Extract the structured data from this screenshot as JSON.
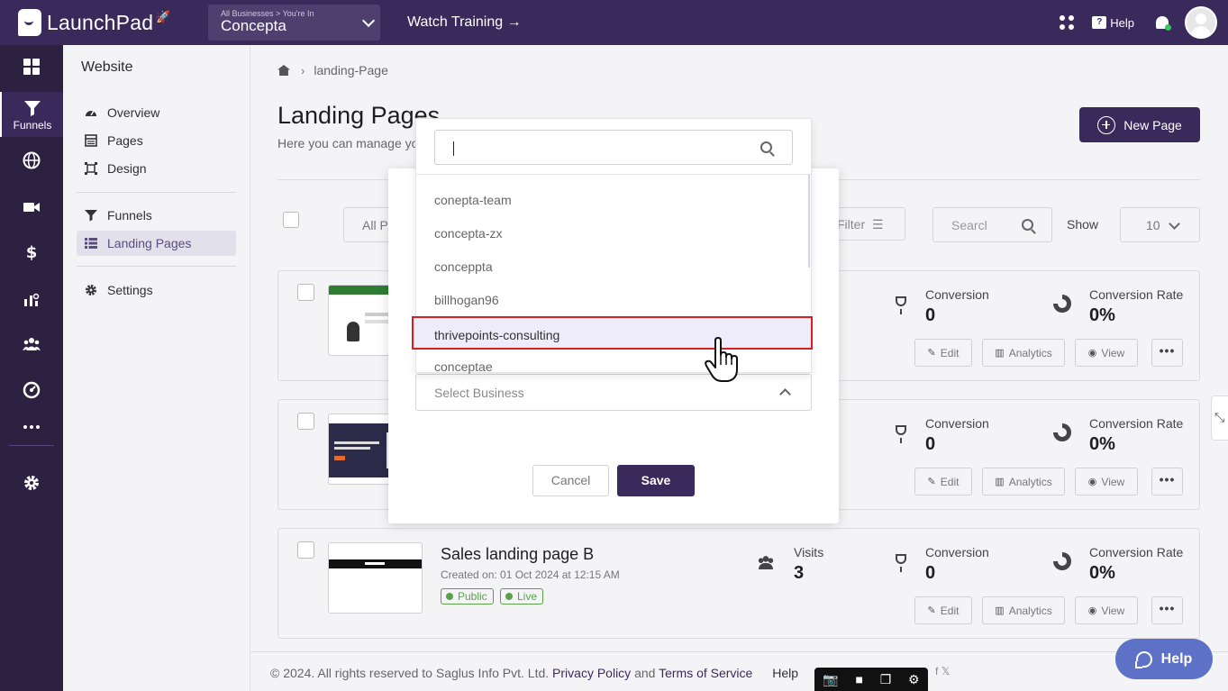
{
  "topbar": {
    "logo_text": "LaunchPad",
    "business_crumb": "All Businesses > You're In",
    "business_name": "Concepta",
    "watch_training": "Watch Training →",
    "help_label": "Help"
  },
  "rail": {
    "active_label": "Funnels"
  },
  "sidebar": {
    "title": "Website",
    "items": [
      {
        "label": "Overview",
        "icon": "dashboard-icon"
      },
      {
        "label": "Pages",
        "icon": "pages-icon"
      },
      {
        "label": "Design",
        "icon": "design-icon"
      },
      {
        "label": "Funnels",
        "icon": "funnel-icon"
      },
      {
        "label": "Landing Pages",
        "icon": "list-icon"
      },
      {
        "label": "Settings",
        "icon": "gear-icon"
      }
    ]
  },
  "main": {
    "breadcrumb": "landing-Page",
    "title": "Landing Pages",
    "subtitle": "Here you can manage yo",
    "new_page_label": "New Page",
    "filter_all": "All P",
    "filter_label": "Filter",
    "search_placeholder": "Searcl",
    "show_label": "Show",
    "show_value": "10"
  },
  "cards": [
    {
      "name": "",
      "date": "",
      "visits_label": "",
      "visits_value": "",
      "conversion_label": "Conversion",
      "conversion_value": "0",
      "rate_label": "Conversion Rate",
      "rate_value": "0%"
    },
    {
      "name": "",
      "date": "",
      "visits_label": "",
      "visits_value": "",
      "conversion_label": "Conversion",
      "conversion_value": "0",
      "rate_label": "Conversion Rate",
      "rate_value": "0%"
    },
    {
      "name": "Sales landing page B",
      "date": "Created on: 01 Oct 2024 at 12:15 AM",
      "public_tag": "Public",
      "live_tag": "Live",
      "visits_label": "Visits",
      "visits_value": "3",
      "conversion_label": "Conversion",
      "conversion_value": "0",
      "rate_label": "Conversion Rate",
      "rate_value": "0%"
    }
  ],
  "actions": {
    "edit": "Edit",
    "analytics": "Analytics",
    "view": "View",
    "more": "•••"
  },
  "footer": {
    "copyright": "©  2024. All rights reserved to Saglus Info Pvt. Ltd.",
    "privacy": "Privacy Policy",
    "and": "and",
    "terms": "Terms of Service",
    "help": "Help"
  },
  "modal": {
    "cancel_label": "Cancel",
    "save_label": "Save",
    "select_placeholder": "Select Business"
  },
  "dropdown": {
    "search_value": "",
    "options": [
      "conepta-team",
      "concepta-zx",
      "conceppta",
      "billhogan96",
      "thrivepoints-consulting",
      "conceptae"
    ],
    "highlighted": "thrivepoints-consulting"
  },
  "help_float": "Help",
  "colors": {
    "brand": "#3a2a5c",
    "highlight_border": "#d62020",
    "help_button": "#5d72c7"
  }
}
